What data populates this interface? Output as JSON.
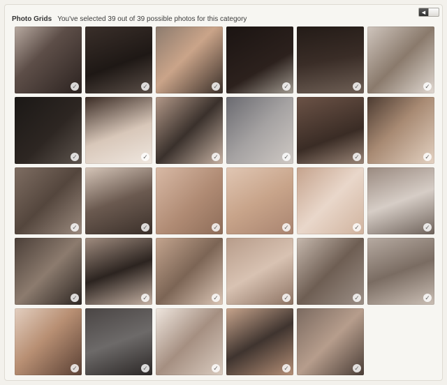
{
  "header": {
    "title": "Photo Grids",
    "subtitle": "You've selected 39 out of 39 possible photos for this category"
  },
  "nav": {
    "prev_glyph": "◀",
    "next_glyph": ""
  },
  "check_glyph": "✓",
  "tiles": [
    {
      "bg": "linear-gradient(135deg,#b7a9a0 0%,#5d4e48 40%,#2c2320 100%)"
    },
    {
      "bg": "linear-gradient(160deg,#3a2f2a 0%,#1e1815 55%,#5a4e47 100%)"
    },
    {
      "bg": "linear-gradient(135deg,#8c7b6e 0%,#caa489 45%,#3b302a 100%)"
    },
    {
      "bg": "linear-gradient(150deg,#1b1412 0%,#2c211d 60%,#a19a90 100%)"
    },
    {
      "bg": "linear-gradient(170deg,#231b17 0%,#3a2d27 50%,#6e5f55 100%)"
    },
    {
      "bg": "linear-gradient(135deg,#cfc5bd 0%,#8a7a6c 50%,#e1d9d2 100%)"
    },
    {
      "bg": "linear-gradient(135deg,#1b1816 0%,#2d2622 55%,#5d544d 100%)"
    },
    {
      "bg": "linear-gradient(160deg,#3b2c25 0%,#d8c7b9 55%,#efe7df 100%)"
    },
    {
      "bg": "linear-gradient(135deg,#b29888 0%,#3a312c 50%,#c7b2a3 100%)"
    },
    {
      "bg": "linear-gradient(135deg,#6a6a70 0%,#a5a2a2 50%,#cfc9c4 100%)"
    },
    {
      "bg": "linear-gradient(160deg,#6b5246 0%,#3a2c25 60%,#9a8577 100%)"
    },
    {
      "bg": "linear-gradient(135deg,#4c3b31 0%,#a88a73 45%,#e4d2c2 100%)"
    },
    {
      "bg": "linear-gradient(135deg,#7e6d62 0%,#54463d 50%,#9b8a7e 100%)"
    },
    {
      "bg": "linear-gradient(160deg,#d5c5b8 0%,#6b5a50 50%,#3b302a 100%)"
    },
    {
      "bg": "linear-gradient(135deg,#d8b9a5 0%,#b08b74 55%,#8e6d59 100%)"
    },
    {
      "bg": "linear-gradient(150deg,#e0c6b3 0%,#c8a48a 50%,#a98470 100%)"
    },
    {
      "bg": "linear-gradient(135deg,#c5a38d 0%,#e9d7ca 50%,#d0b39e 100%)"
    },
    {
      "bg": "linear-gradient(160deg,#9a8a80 0%,#d6cdc6 50%,#6e625a 100%)"
    },
    {
      "bg": "linear-gradient(135deg,#4b3f38 0%,#8c7b6e 50%,#2d2622 100%)"
    },
    {
      "bg": "linear-gradient(160deg,#a08c7f 0%,#2c2420 50%,#c5b1a3 100%)"
    },
    {
      "bg": "linear-gradient(135deg,#c3a48e 0%,#7c6555 50%,#dcc6b6 100%)"
    },
    {
      "bg": "linear-gradient(150deg,#b79c8a 0%,#d8c2b2 50%,#8c7262 100%)"
    },
    {
      "bg": "linear-gradient(135deg,#c6b8ad 0%,#6e5e53 50%,#9c8f86 100%)"
    },
    {
      "bg": "linear-gradient(160deg,#b6aaa1 0%,#7a6c62 50%,#cbbfb5 100%)"
    },
    {
      "bg": "linear-gradient(135deg,#e3cfc0 0%,#b88f73 45%,#5a4034 100%)"
    },
    {
      "bg": "linear-gradient(160deg,#4a4544 0%,#6d6a69 50%,#2b2726 100%)"
    },
    {
      "bg": "linear-gradient(135deg,#efe6de 0%,#a58f81 50%,#d9cbbf 100%)"
    },
    {
      "bg": "linear-gradient(150deg,#c7a48c 0%,#3f342f 50%,#b58f76 100%)"
    },
    {
      "bg": "linear-gradient(135deg,#7b6a60 0%,#b69d8c 50%,#4a3d36 100%)"
    }
  ]
}
